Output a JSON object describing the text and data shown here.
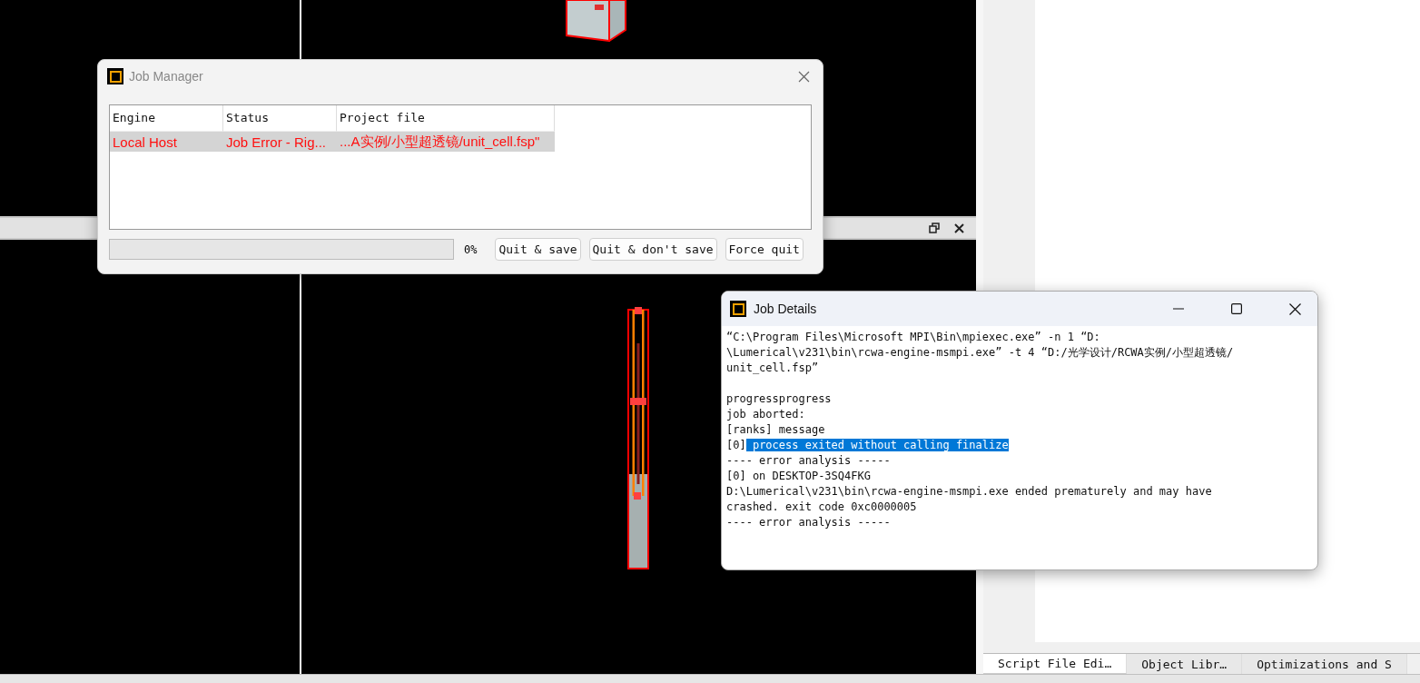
{
  "job_manager": {
    "title": "Job Manager",
    "table": {
      "columns": [
        "Engine",
        "Status",
        "Project file"
      ],
      "rows": [
        {
          "cells": [
            "Local Host",
            "Job Error - Rig...",
            "...A实例/小型超透镜/unit_cell.fsp\""
          ],
          "selected": true,
          "error": true
        }
      ]
    },
    "progress": {
      "level": 0,
      "reading": "0%"
    },
    "buttons": [
      "Quit & save",
      "Quit & don't save",
      "Force quit"
    ]
  },
  "job_details": {
    "title": "Job Details",
    "log_paragraphs": [
      [
        {
          "text": "“C:\\Program Files\\Microsoft MPI\\Bin\\mpiexec.exe” -n 1 “D:"
        },
        {
          "text": "\\Lumerical\\v231\\bin\\rcwa-engine-msmpi.exe” -t 4 “D:/光学设计/RCWA实例/小型超透镜/"
        },
        {
          "text": "unit_cell.fsp”"
        }
      ],
      [
        {
          "text": "progressprogress"
        },
        {
          "text": "job aborted:"
        },
        {
          "text": "[ranks] message"
        },
        {
          "text": "[0]",
          "selected_text": " process exited without calling finalize"
        },
        {
          "text": "---- error analysis -----"
        },
        {
          "text": "[0] on DESKTOP-3SQ4FKG"
        },
        {
          "text": "D:\\Lumerical\\v231\\bin\\rcwa-engine-msmpi.exe ended prematurely and may have"
        },
        {
          "text": "crashed. exit code 0xc0000005"
        },
        {
          "text": "---- error analysis -----"
        }
      ]
    ]
  },
  "bottom_tabs": [
    {
      "label": "Script File Edi…",
      "selected": true
    },
    {
      "label": "Object Libr…",
      "selected": false
    },
    {
      "label": "Optimizations and S",
      "selected": false
    }
  ]
}
